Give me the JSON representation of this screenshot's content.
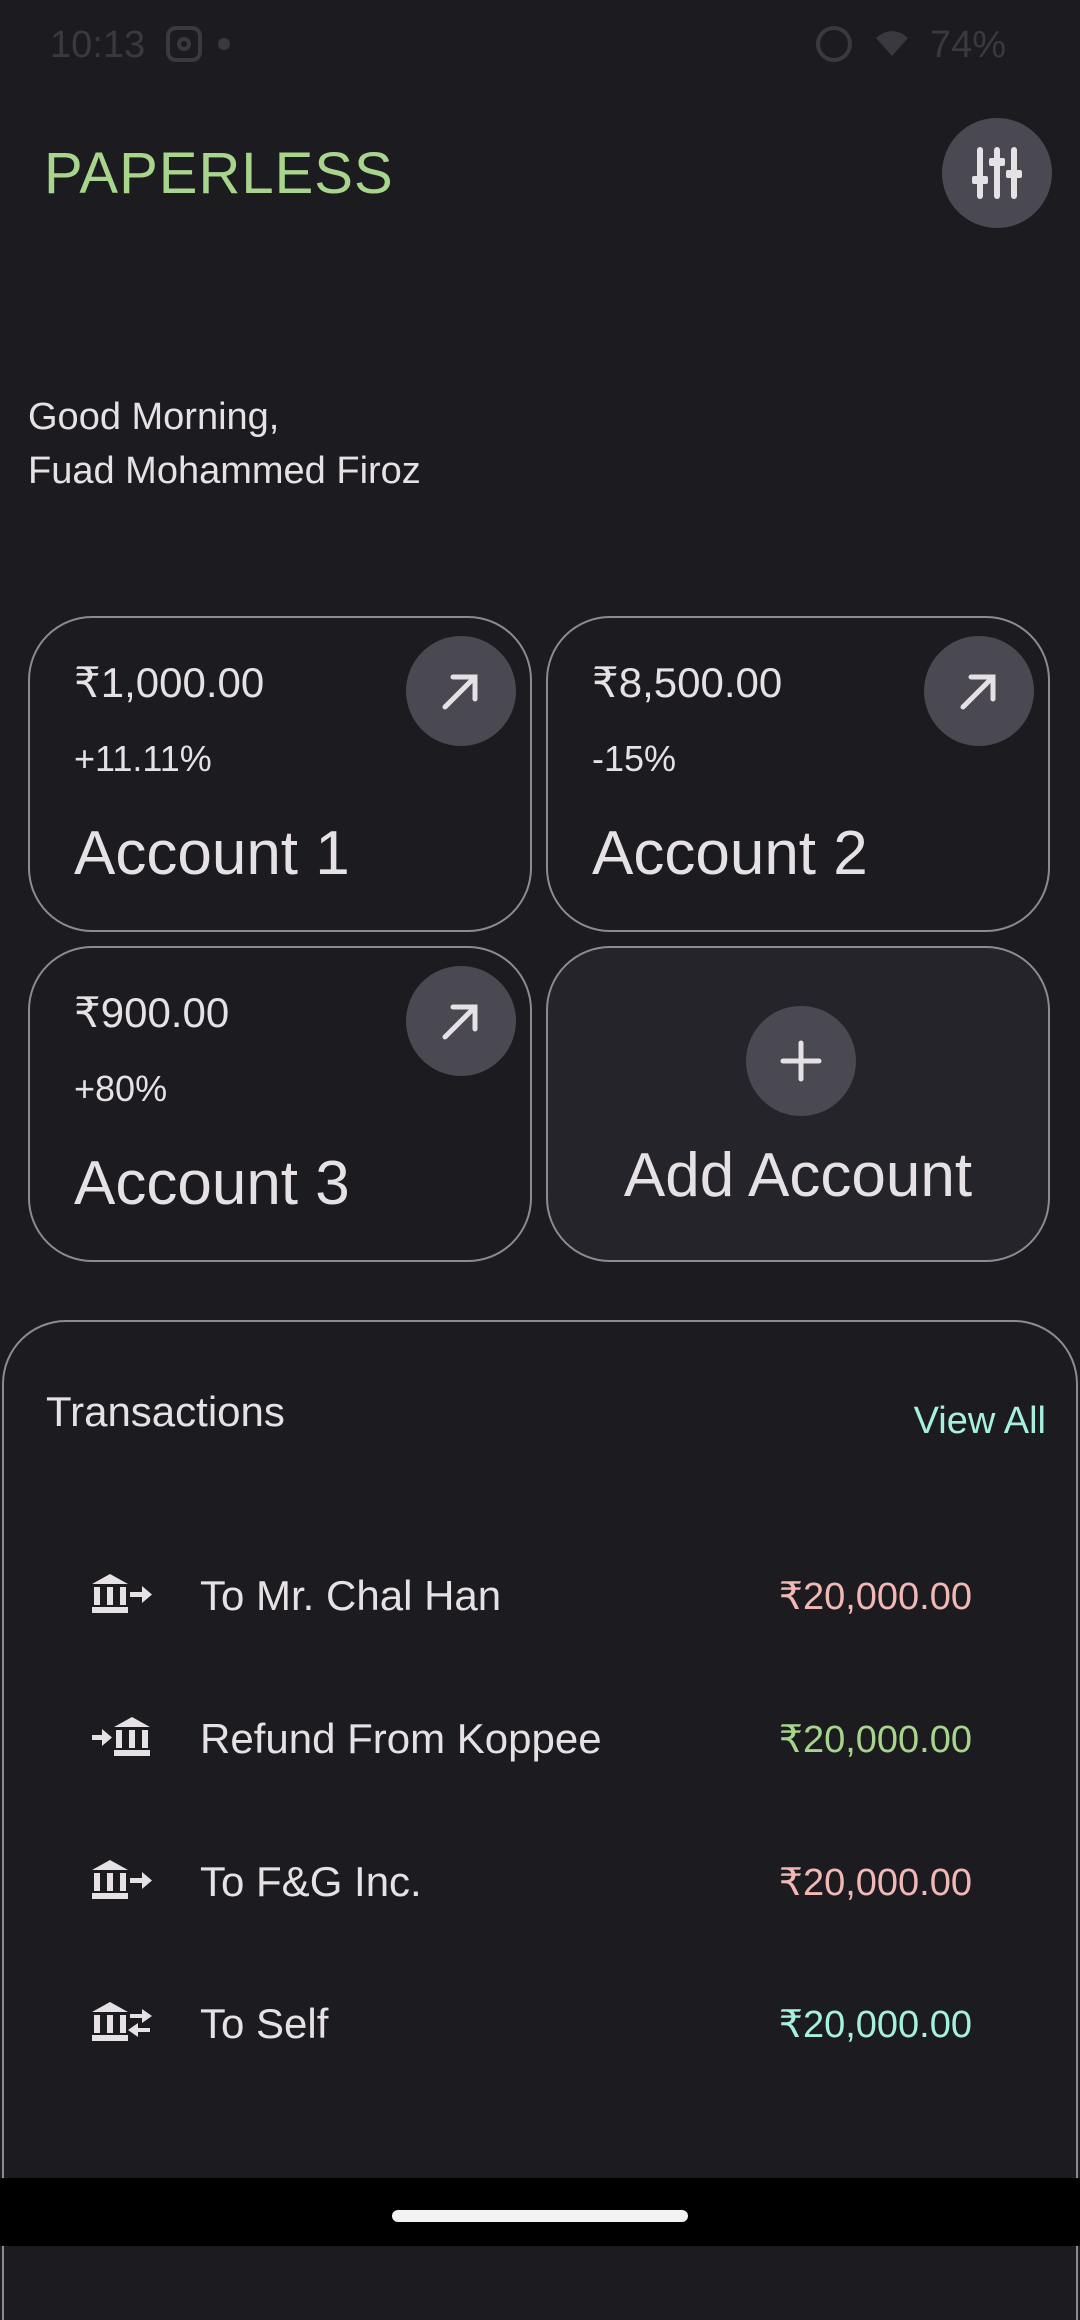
{
  "status_bar": {
    "time": "10:13",
    "battery": "74%"
  },
  "header": {
    "app_title": "PAPERLESS",
    "settings_icon": "tune-sliders-icon"
  },
  "greeting": {
    "line1": "Good Morning,",
    "line2": "Fuad Mohammed Firoz"
  },
  "accounts": [
    {
      "balance": "₹1,000.00",
      "change": "+11.11%",
      "name": "Account 1"
    },
    {
      "balance": "₹8,500.00",
      "change": "-15%",
      "name": "Account 2"
    },
    {
      "balance": "₹900.00",
      "change": "+80%",
      "name": "Account 3"
    }
  ],
  "add_account": {
    "label": "Add Account",
    "icon": "plus-icon"
  },
  "transactions": {
    "title": "Transactions",
    "view_all": "View All",
    "items": [
      {
        "label": "To Mr. Chal Han",
        "amount": "₹20,000.00",
        "type": "outgoing",
        "icon": "bank-transfer-out-icon"
      },
      {
        "label": "Refund From Koppee",
        "amount": "₹20,000.00",
        "type": "incoming",
        "icon": "bank-transfer-in-icon"
      },
      {
        "label": "To F&G Inc.",
        "amount": "₹20,000.00",
        "type": "outgoing",
        "icon": "bank-transfer-out-icon"
      },
      {
        "label": "To Self",
        "amount": "₹20,000.00",
        "type": "self",
        "icon": "bank-transfer-self-icon"
      }
    ]
  },
  "colors": {
    "background": "#1c1b20",
    "brand": "#a8d58c",
    "outgoing": "#f2b8b5",
    "incoming": "#a8d58c",
    "self": "#a6f0e0"
  }
}
